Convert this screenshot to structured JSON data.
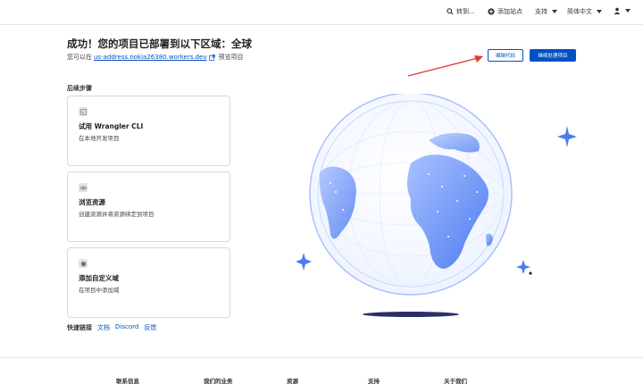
{
  "topbar": {
    "goto_label": "转到...",
    "add_site_label": "添加站点",
    "support_label": "支持",
    "language_label": "简体中文"
  },
  "header": {
    "title": "成功！您的项目已部署到以下区域：全球",
    "subline_prefix": "您可以在",
    "project_url": "us-address.nokia26380.workers.dev",
    "subline_suffix": "预览项目",
    "edit_code_label": "编辑代码",
    "continue_label": "继续处理项目"
  },
  "next_steps": {
    "label": "后续步骤",
    "cards": [
      {
        "title": "试用 Wrangler CLI",
        "desc": "在本地开发项目"
      },
      {
        "title": "浏览资源",
        "desc": "创建资源并将资源绑定到项目"
      },
      {
        "title": "添加自定义域",
        "desc": "在项目中添加域"
      }
    ]
  },
  "quick_links": {
    "label": "快速链接",
    "items": [
      "文档",
      "Discord",
      "反馈"
    ]
  },
  "footer": {
    "columns": [
      "联系信息",
      "我们的业务",
      "资源",
      "支持",
      "关于我们"
    ]
  },
  "colors": {
    "accent": "#0051c3",
    "annotation_red": "#e53935",
    "globe_blue": "#5b8def"
  }
}
